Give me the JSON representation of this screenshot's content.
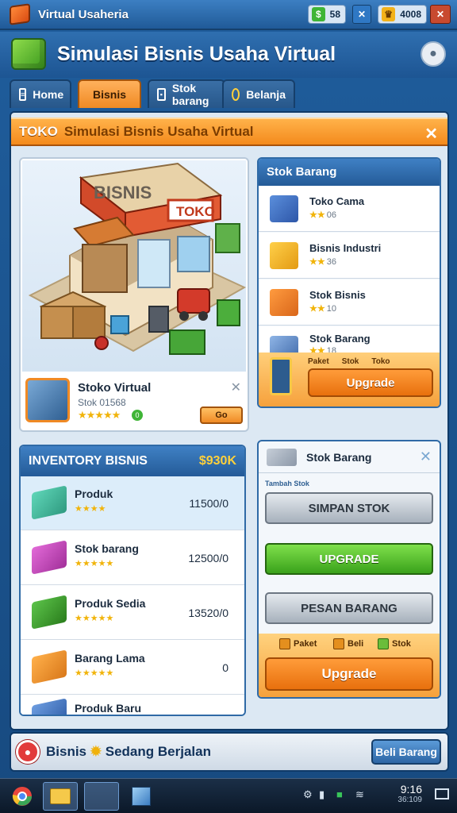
{
  "window": {
    "title": "Virtual Usaheria",
    "coins": "58",
    "gems": "4008"
  },
  "app": {
    "title": "Simulasi Bisnis Usaha Virtual"
  },
  "tabs": [
    {
      "label": "Home",
      "active": false
    },
    {
      "label": "Bisnis",
      "active": true
    },
    {
      "label": "Stok barang",
      "active": false
    },
    {
      "label": "Belanja",
      "active": false
    }
  ],
  "banner": {
    "tag": "TOKO",
    "text": "Simulasi Bisnis Usaha Virtual"
  },
  "store": {
    "sign_main": "BISNIS",
    "sign_side": "TOKO",
    "name": "Stoko Virtual",
    "sub": "Stok 01568",
    "stars": "★★★★★",
    "badge": "0",
    "go_label": "Go"
  },
  "supplier": {
    "title": "Stok Barang",
    "items": [
      {
        "name": "Toko Cama",
        "stars": "★★",
        "count": "06"
      },
      {
        "name": "Bisnis Industri",
        "stars": "★★",
        "count": "36"
      },
      {
        "name": "Stok Bisnis",
        "stars": "★★",
        "count": "10"
      },
      {
        "name": "Stok Barang",
        "stars": "★★",
        "count": "18"
      }
    ],
    "labels": [
      "Paket",
      "Stok",
      "Toko"
    ],
    "button": "Upgrade"
  },
  "inventory": {
    "title": "INVENTORY BISNIS",
    "total": "$930K",
    "items": [
      {
        "name": "Produk",
        "stars": "★★★★",
        "value": "11500/0",
        "selected": true
      },
      {
        "name": "Stok barang",
        "stars": "★★★★★",
        "value": "12500/0",
        "selected": false
      },
      {
        "name": "Produk Sedia",
        "stars": "★★★★★",
        "value": "13520/0",
        "selected": false
      },
      {
        "name": "Barang Lama",
        "stars": "★★★★★",
        "value": "0",
        "selected": false
      },
      {
        "name": "Produk Baru",
        "stars": "★★★★",
        "value": "",
        "selected": false
      }
    ]
  },
  "actions": {
    "title": "Stok Barang",
    "caption": "Tambah Stok",
    "btn1": "SIMPAN STOK",
    "btn2": "UPGRADE",
    "btn3": "PESAN BARANG",
    "mini": [
      "Paket",
      "Beli",
      "Stok"
    ],
    "button": "Upgrade"
  },
  "status": {
    "message_left": "Bisnis",
    "message_right": "Sedang Berjalan",
    "button": "Beli Barang"
  },
  "taskbar": {
    "time": "9:16",
    "date": "36:109"
  }
}
